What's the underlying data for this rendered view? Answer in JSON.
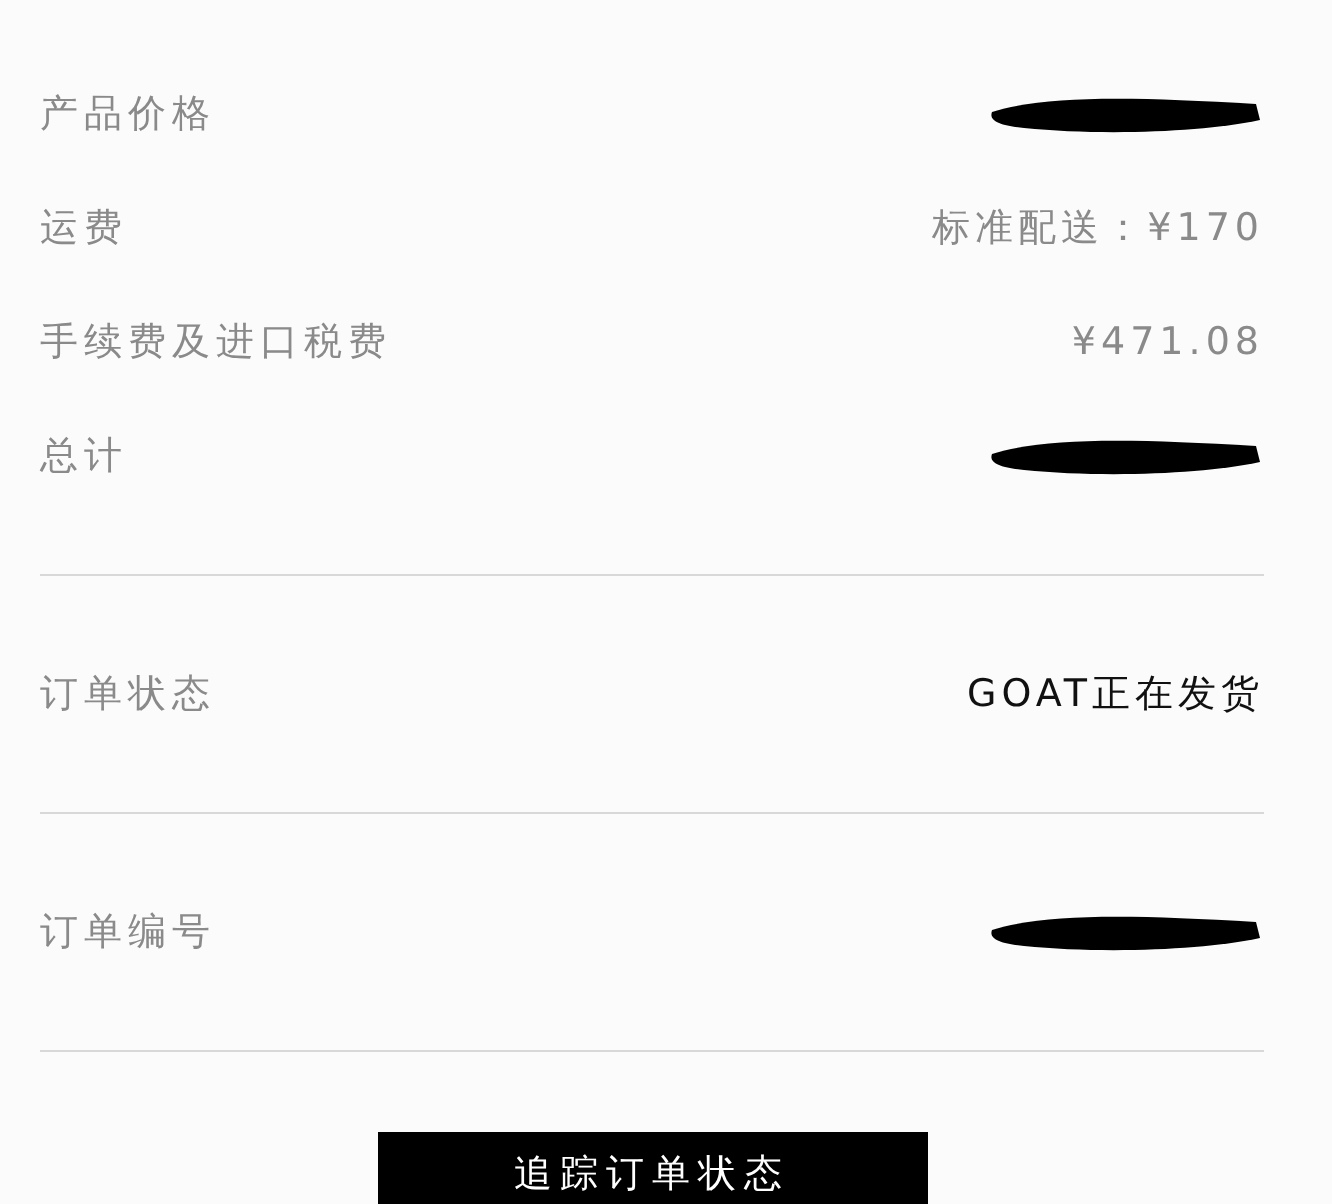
{
  "price_rows": [
    {
      "label": "产品价格",
      "kind": "redacted"
    },
    {
      "label": "运费",
      "kind": "text",
      "value": "标准配送：¥170"
    },
    {
      "label": "手续费及进口税费",
      "kind": "text",
      "value": "¥471.08"
    },
    {
      "label": "总计",
      "kind": "redacted"
    }
  ],
  "info_rows": [
    {
      "label": "订单状态",
      "kind": "strong",
      "value": "GOAT正在发货"
    },
    {
      "label": "订单编号",
      "kind": "redacted"
    }
  ],
  "button": "追踪订单状态"
}
